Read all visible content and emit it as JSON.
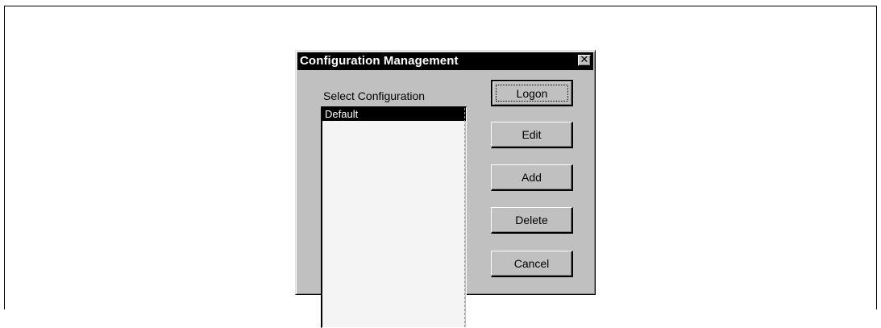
{
  "dialog": {
    "title": "Configuration Management",
    "close_glyph": "✕",
    "close_icon": "close-icon"
  },
  "select": {
    "label": "Select Configuration",
    "items": [
      {
        "label": "Default",
        "selected": true
      }
    ]
  },
  "buttons": {
    "logon": "Logon",
    "edit": "Edit",
    "add": "Add",
    "delete": "Delete",
    "cancel": "Cancel"
  },
  "colors": {
    "dialog_face": "#c0c0c0",
    "titlebar": "#000000",
    "selection": "#000000",
    "list_background": "#f4f4f4"
  }
}
